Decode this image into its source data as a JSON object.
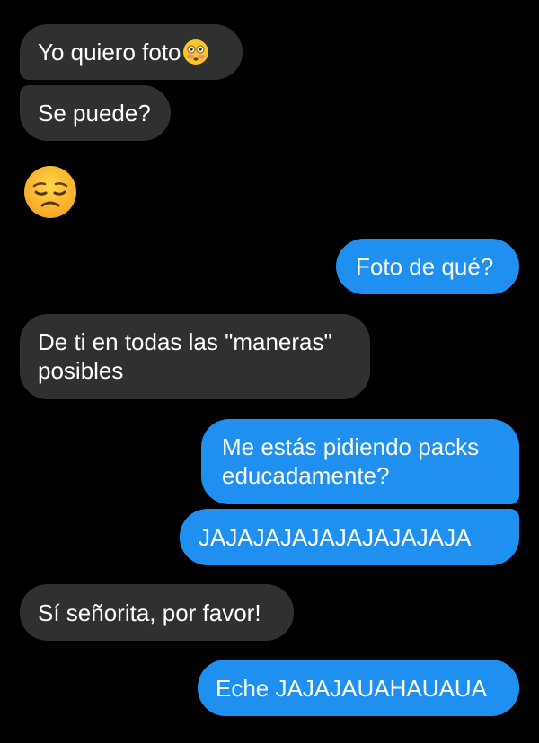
{
  "conversation": {
    "messages": [
      {
        "sender": "other",
        "text": "Yo quiero foto",
        "emoji": "flushed-face-icon"
      },
      {
        "sender": "other",
        "text": "Se puede?"
      },
      {
        "sender": "other",
        "emoji": "disappointed-face-icon"
      },
      {
        "sender": "me",
        "text": "Foto de qué?"
      },
      {
        "sender": "other",
        "text": "De ti en todas las \"maneras\"",
        "text2": "posibles"
      },
      {
        "sender": "me",
        "text": "Me estás pidiendo packs",
        "text2": "educadamente?"
      },
      {
        "sender": "me",
        "text": "JAJAJAJAJAJAJAJAJAJA"
      },
      {
        "sender": "other",
        "text": "Sí señorita, por favor!"
      },
      {
        "sender": "me",
        "text": "Eche JAJAJAUAHAUAUA"
      }
    ]
  },
  "colors": {
    "background": "#000000",
    "incoming_bubble": "#303030",
    "outgoing_bubble": "#1f8ff0",
    "text": "#ffffff"
  }
}
